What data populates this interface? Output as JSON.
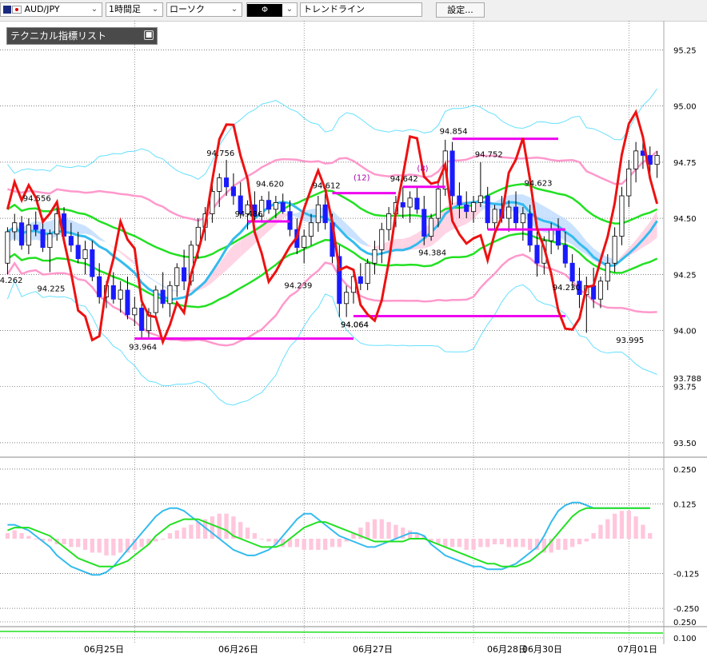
{
  "toolbar": {
    "symbol": "AUD/JPY",
    "timeframe": "1時間足",
    "chart_type": "ローソク",
    "draw_mode": "Φ",
    "tool": "トレンドライン",
    "settings_label": "設定..."
  },
  "indicator_panel": {
    "title": "テクニカル指標リスト",
    "icon": "collapse-square-icon"
  },
  "colors": {
    "up_candle": "#ffffff",
    "down_candle": "#1a1aff",
    "bb_outer": "#66e0ff",
    "bb_inner": "#ff99cc",
    "ma_green": "#22e022",
    "ma_blue": "#33bbee",
    "rsi_red": "#ee1111",
    "trend_line": "#ee00ee",
    "cloud_blue": "#b8d8ff",
    "cloud_pink": "#ffc6dc"
  },
  "chart_data": [
    {
      "type": "candlestick",
      "price_axis_ticks": [
        "95.25",
        "95.00",
        "94.75",
        "94.50",
        "94.25",
        "94.00",
        "93.75",
        "93.50"
      ],
      "ylim": [
        93.45,
        95.33
      ],
      "x_labels": [
        "06月25日",
        "06月26日",
        "06月27日",
        "06月28日",
        "06月30日",
        "07月01日"
      ],
      "current_price_marker": "93.788",
      "price_annotations": [
        {
          "label": "94.556",
          "value": 94.556
        },
        {
          "label": "94.262",
          "value": 94.262
        },
        {
          "label": "94.225",
          "value": 94.225
        },
        {
          "label": "93.964",
          "value": 93.964
        },
        {
          "label": "94.756",
          "value": 94.756
        },
        {
          "label": "94.620",
          "value": 94.62
        },
        {
          "label": "94.486",
          "value": 94.486
        },
        {
          "label": "94.612",
          "value": 94.612
        },
        {
          "label": "94.239",
          "value": 94.239
        },
        {
          "label": "94.064",
          "value": 94.064
        },
        {
          "label": "94.064",
          "value": 94.064
        },
        {
          "label": "94.642",
          "value": 94.642
        },
        {
          "label": "94.384",
          "value": 94.384
        },
        {
          "label": "94.854",
          "value": 94.854
        },
        {
          "label": "94.752",
          "value": 94.752
        },
        {
          "label": "94.623",
          "value": 94.623
        },
        {
          "label": "94.230",
          "value": 94.23
        },
        {
          "label": "93.995",
          "value": 93.995
        }
      ],
      "count_labels": [
        "(12)",
        "(8)"
      ],
      "candles": [
        [
          94.3,
          94.46,
          94.25,
          94.44
        ],
        [
          94.44,
          94.52,
          94.4,
          94.48
        ],
        [
          94.48,
          94.51,
          94.36,
          94.38
        ],
        [
          94.38,
          94.5,
          94.34,
          94.47
        ],
        [
          94.47,
          94.53,
          94.42,
          94.45
        ],
        [
          94.45,
          94.5,
          94.35,
          94.37
        ],
        [
          94.37,
          94.45,
          94.26,
          94.43
        ],
        [
          94.43,
          94.56,
          94.4,
          94.52
        ],
        [
          94.52,
          94.55,
          94.4,
          94.42
        ],
        [
          94.42,
          94.48,
          94.35,
          94.38
        ],
        [
          94.38,
          94.44,
          94.3,
          94.32
        ],
        [
          94.32,
          94.4,
          94.25,
          94.36
        ],
        [
          94.36,
          94.4,
          94.22,
          94.24
        ],
        [
          94.24,
          94.3,
          94.12,
          94.15
        ],
        [
          94.15,
          94.22,
          94.1,
          94.2
        ],
        [
          94.2,
          94.26,
          94.12,
          94.14
        ],
        [
          94.14,
          94.22,
          94.08,
          94.18
        ],
        [
          94.18,
          94.24,
          94.05,
          94.07
        ],
        [
          94.07,
          94.15,
          94.02,
          94.1
        ],
        [
          94.1,
          94.12,
          93.96,
          94.0
        ],
        [
          94.0,
          94.1,
          93.97,
          94.08
        ],
        [
          94.08,
          94.2,
          94.05,
          94.18
        ],
        [
          94.18,
          94.26,
          94.1,
          94.12
        ],
        [
          94.12,
          94.22,
          94.06,
          94.2
        ],
        [
          94.2,
          94.3,
          94.15,
          94.28
        ],
        [
          94.28,
          94.36,
          94.18,
          94.22
        ],
        [
          94.22,
          94.4,
          94.2,
          94.38
        ],
        [
          94.38,
          94.5,
          94.32,
          94.46
        ],
        [
          94.46,
          94.55,
          94.4,
          94.52
        ],
        [
          94.52,
          94.66,
          94.48,
          94.62
        ],
        [
          94.62,
          94.7,
          94.55,
          94.68
        ],
        [
          94.68,
          94.76,
          94.6,
          94.64
        ],
        [
          94.64,
          94.7,
          94.56,
          94.6
        ],
        [
          94.6,
          94.66,
          94.5,
          94.52
        ],
        [
          94.52,
          94.58,
          94.45,
          94.56
        ],
        [
          94.56,
          94.62,
          94.49,
          94.51
        ],
        [
          94.51,
          94.6,
          94.48,
          94.58
        ],
        [
          94.58,
          94.62,
          94.52,
          94.54
        ],
        [
          94.54,
          94.6,
          94.5,
          94.57
        ],
        [
          94.57,
          94.61,
          94.52,
          94.53
        ],
        [
          94.53,
          94.58,
          94.42,
          94.45
        ],
        [
          94.45,
          94.5,
          94.34,
          94.37
        ],
        [
          94.37,
          94.45,
          94.3,
          94.42
        ],
        [
          94.42,
          94.52,
          94.38,
          94.48
        ],
        [
          94.48,
          94.6,
          94.44,
          94.56
        ],
        [
          94.56,
          94.61,
          94.45,
          94.48
        ],
        [
          94.48,
          94.52,
          94.3,
          94.33
        ],
        [
          94.33,
          94.38,
          94.06,
          94.12
        ],
        [
          94.12,
          94.2,
          94.06,
          94.17
        ],
        [
          94.17,
          94.26,
          94.12,
          94.24
        ],
        [
          94.24,
          94.3,
          94.18,
          94.21
        ],
        [
          94.21,
          94.32,
          94.18,
          94.3
        ],
        [
          94.3,
          94.4,
          94.25,
          94.36
        ],
        [
          94.36,
          94.48,
          94.3,
          94.45
        ],
        [
          94.45,
          94.55,
          94.4,
          94.52
        ],
        [
          94.52,
          94.6,
          94.46,
          94.57
        ],
        [
          94.57,
          94.64,
          94.5,
          94.55
        ],
        [
          94.55,
          94.62,
          94.48,
          94.59
        ],
        [
          94.59,
          94.64,
          94.52,
          94.54
        ],
        [
          94.54,
          94.6,
          94.38,
          94.42
        ],
        [
          94.42,
          94.52,
          94.4,
          94.5
        ],
        [
          94.5,
          94.66,
          94.46,
          94.63
        ],
        [
          94.63,
          94.85,
          94.6,
          94.8
        ],
        [
          94.8,
          94.84,
          94.56,
          94.6
        ],
        [
          94.6,
          94.66,
          94.5,
          94.56
        ],
        [
          94.56,
          94.62,
          94.5,
          94.53
        ],
        [
          94.53,
          94.6,
          94.48,
          94.57
        ],
        [
          94.57,
          94.75,
          94.55,
          94.6
        ],
        [
          94.6,
          94.64,
          94.45,
          94.48
        ],
        [
          94.48,
          94.56,
          94.44,
          94.54
        ],
        [
          94.54,
          94.6,
          94.48,
          94.5
        ],
        [
          94.5,
          94.58,
          94.44,
          94.55
        ],
        [
          94.55,
          94.62,
          94.45,
          94.48
        ],
        [
          94.48,
          94.55,
          94.4,
          94.52
        ],
        [
          94.52,
          94.56,
          94.35,
          94.38
        ],
        [
          94.38,
          94.44,
          94.24,
          94.3
        ],
        [
          94.3,
          94.42,
          94.25,
          94.4
        ],
        [
          94.4,
          94.48,
          94.34,
          94.45
        ],
        [
          94.45,
          94.5,
          94.36,
          94.38
        ],
        [
          94.38,
          94.44,
          94.28,
          94.3
        ],
        [
          94.3,
          94.34,
          94.18,
          94.22
        ],
        [
          94.22,
          94.28,
          94.1,
          94.16
        ],
        [
          94.16,
          94.24,
          93.99,
          94.2
        ],
        [
          94.2,
          94.28,
          94.1,
          94.14
        ],
        [
          94.14,
          94.24,
          94.1,
          94.22
        ],
        [
          94.22,
          94.34,
          94.18,
          94.3
        ],
        [
          94.3,
          94.46,
          94.26,
          94.42
        ],
        [
          94.42,
          94.64,
          94.38,
          94.6
        ],
        [
          94.6,
          94.76,
          94.55,
          94.72
        ],
        [
          94.72,
          94.84,
          94.66,
          94.8
        ],
        [
          94.8,
          94.86,
          94.72,
          94.78
        ],
        [
          94.78,
          94.82,
          94.7,
          94.74
        ],
        [
          94.74,
          94.8,
          94.68,
          94.78
        ]
      ],
      "trend_lines": [
        {
          "value": 94.854
        },
        {
          "value": 94.064
        },
        {
          "value": 93.964
        },
        {
          "value": 94.486
        },
        {
          "value": 94.612
        },
        {
          "value": 94.64
        },
        {
          "value": 94.45
        }
      ]
    },
    {
      "type": "oscillator",
      "axis_ticks": [
        "0.250",
        "0.125",
        "-0.125",
        "-0.250"
      ],
      "ylim": [
        -0.27,
        0.27
      ],
      "histogram": [
        0.02,
        0.03,
        0.02,
        0.01,
        0.0,
        -0.01,
        -0.01,
        -0.02,
        -0.02,
        -0.03,
        -0.03,
        -0.04,
        -0.05,
        -0.05,
        -0.06,
        -0.06,
        -0.05,
        -0.05,
        -0.04,
        -0.03,
        -0.02,
        -0.01,
        0.0,
        0.02,
        0.03,
        0.04,
        0.05,
        0.06,
        0.07,
        0.08,
        0.09,
        0.09,
        0.08,
        0.06,
        0.04,
        0.02,
        0.0,
        -0.01,
        -0.02,
        -0.03,
        -0.03,
        -0.03,
        -0.04,
        -0.04,
        -0.04,
        -0.04,
        -0.03,
        -0.03,
        -0.01,
        0.02,
        0.04,
        0.06,
        0.07,
        0.07,
        0.06,
        0.05,
        0.04,
        0.03,
        0.02,
        0.01,
        -0.01,
        -0.02,
        -0.03,
        -0.03,
        -0.03,
        -0.04,
        -0.04,
        -0.03,
        -0.03,
        -0.02,
        -0.02,
        -0.03,
        -0.03,
        -0.03,
        -0.04,
        -0.04,
        -0.05,
        -0.05,
        -0.04,
        -0.04,
        -0.03,
        -0.02,
        -0.01,
        0.02,
        0.05,
        0.07,
        0.09,
        0.1,
        0.1,
        0.08,
        0.05,
        0.02
      ],
      "macd": [
        0.05,
        0.05,
        0.04,
        0.03,
        0.01,
        -0.01,
        -0.03,
        -0.06,
        -0.08,
        -0.1,
        -0.11,
        -0.12,
        -0.13,
        -0.13,
        -0.12,
        -0.1,
        -0.07,
        -0.04,
        -0.01,
        0.02,
        0.05,
        0.08,
        0.1,
        0.11,
        0.11,
        0.1,
        0.08,
        0.06,
        0.04,
        0.02,
        0.0,
        -0.02,
        -0.04,
        -0.05,
        -0.06,
        -0.06,
        -0.05,
        -0.04,
        -0.02,
        0.01,
        0.04,
        0.07,
        0.09,
        0.09,
        0.07,
        0.05,
        0.03,
        0.01,
        0.0,
        -0.01,
        -0.02,
        -0.03,
        -0.03,
        -0.02,
        -0.01,
        0.0,
        0.01,
        0.02,
        0.02,
        0.01,
        -0.02,
        -0.04,
        -0.06,
        -0.07,
        -0.08,
        -0.09,
        -0.1,
        -0.1,
        -0.11,
        -0.11,
        -0.11,
        -0.1,
        -0.09,
        -0.07,
        -0.05,
        -0.03,
        0.01,
        0.06,
        0.1,
        0.12,
        0.13,
        0.13,
        0.12,
        0.11,
        0.11,
        0.11,
        0.11,
        0.11,
        0.11,
        0.11,
        0.11,
        0.11
      ],
      "signal": [
        0.03,
        0.04,
        0.04,
        0.04,
        0.03,
        0.02,
        0.01,
        -0.01,
        -0.03,
        -0.05,
        -0.07,
        -0.08,
        -0.09,
        -0.1,
        -0.1,
        -0.1,
        -0.09,
        -0.08,
        -0.06,
        -0.04,
        -0.02,
        0.01,
        0.03,
        0.05,
        0.06,
        0.07,
        0.07,
        0.07,
        0.06,
        0.05,
        0.04,
        0.03,
        0.01,
        0.0,
        -0.01,
        -0.02,
        -0.03,
        -0.03,
        -0.03,
        -0.02,
        0.0,
        0.02,
        0.04,
        0.05,
        0.06,
        0.06,
        0.05,
        0.04,
        0.03,
        0.02,
        0.01,
        0.0,
        -0.01,
        -0.01,
        -0.01,
        -0.01,
        -0.01,
        0.0,
        0.0,
        0.0,
        -0.01,
        -0.02,
        -0.03,
        -0.04,
        -0.05,
        -0.06,
        -0.07,
        -0.08,
        -0.09,
        -0.09,
        -0.1,
        -0.1,
        -0.1,
        -0.09,
        -0.08,
        -0.06,
        -0.04,
        -0.01,
        0.02,
        0.05,
        0.08,
        0.1,
        0.11,
        0.11,
        0.11,
        0.11,
        0.11,
        0.11,
        0.11,
        0.11,
        0.11,
        0.11
      ]
    },
    {
      "type": "sub-indicator",
      "axis_ticks": [
        "0.250",
        "0.100"
      ]
    }
  ]
}
